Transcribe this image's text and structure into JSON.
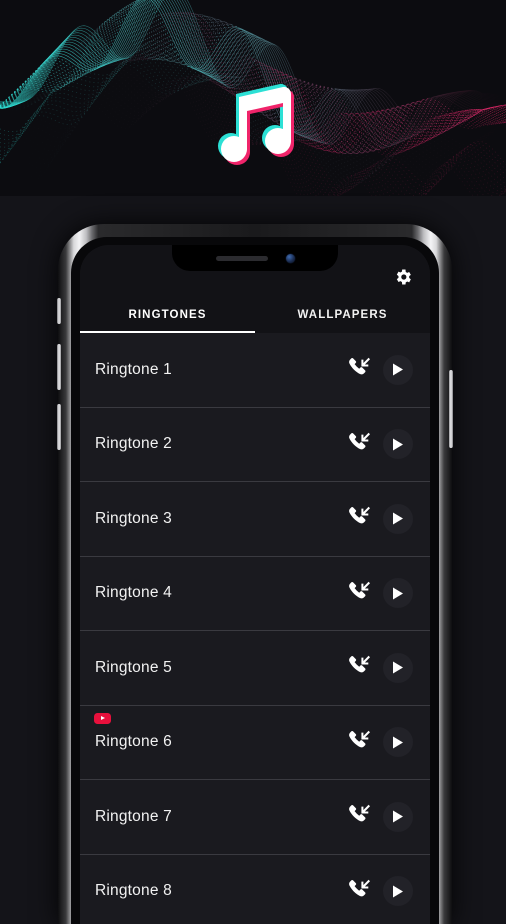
{
  "hero": {
    "logo_icon": "music-note-icon",
    "background_icon": "sound-wave-mesh",
    "accent_cyan": "#2ce0d5",
    "accent_pink": "#f0246a",
    "background_color": "#0c0c10"
  },
  "phone": {
    "notch": {
      "speaker_icon": "earpiece-speaker",
      "camera_icon": "front-camera"
    },
    "side_buttons": [
      "mute-switch",
      "volume-up",
      "volume-down",
      "power"
    ]
  },
  "app": {
    "settings_icon": "gear-icon",
    "tabs": [
      {
        "label": "RINGTONES",
        "active": true
      },
      {
        "label": "WALLPAPERS",
        "active": false
      }
    ],
    "row_icons": {
      "set_ringtone": "phone-incoming-icon",
      "play": "play-icon"
    },
    "ringtones": [
      {
        "title": "Ringtone 1",
        "badge": null
      },
      {
        "title": "Ringtone 2",
        "badge": null
      },
      {
        "title": "Ringtone 3",
        "badge": null
      },
      {
        "title": "Ringtone 4",
        "badge": null
      },
      {
        "title": "Ringtone 5",
        "badge": null
      },
      {
        "title": "Ringtone 6",
        "badge": "youtube-badge"
      },
      {
        "title": "Ringtone 7",
        "badge": null
      },
      {
        "title": "Ringtone 8",
        "badge": null
      }
    ],
    "colors": {
      "screen_background": "#121216",
      "row_background": "#1a1a1f",
      "row_divider": "#3a3a40",
      "text": "#f2f2f2",
      "accent_underline": "#ffffff",
      "badge_red": "#e8103c"
    }
  }
}
